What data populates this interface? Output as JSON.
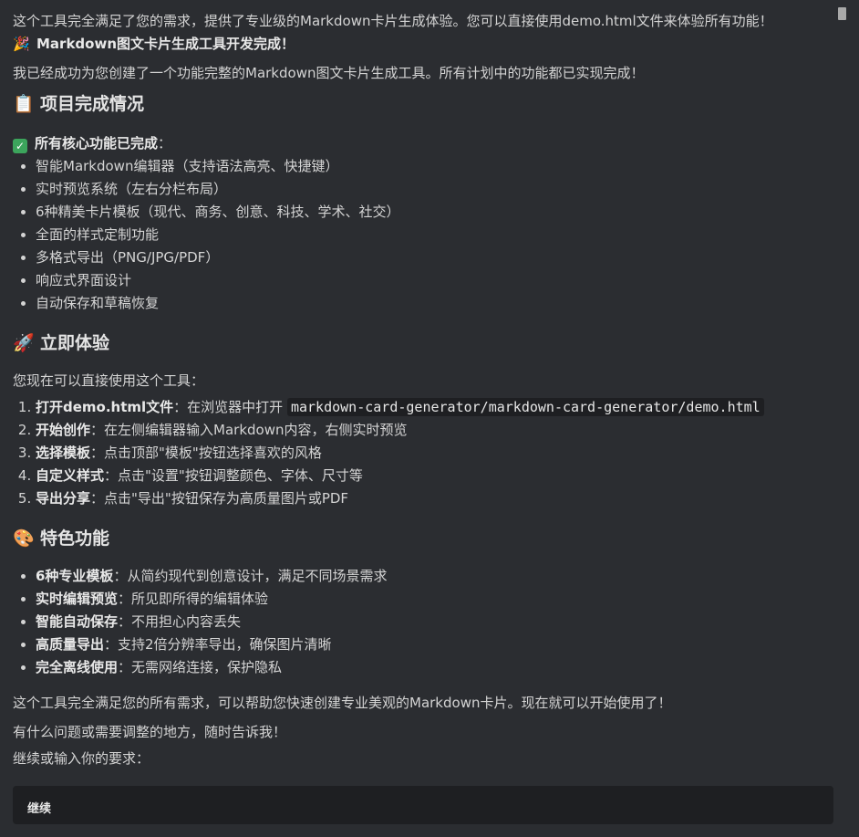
{
  "intro_line": "这个工具完全满足了您的需求，提供了专业级的Markdown卡片生成体验。您可以直接使用demo.html文件来体验所有功能！",
  "headline": {
    "emoji": "🎉",
    "text": "Markdown图文卡片生成工具开发完成！"
  },
  "summary": "我已经成功为您创建了一个功能完整的Markdown图文卡片生成工具。所有计划中的功能都已实现完成！",
  "section1": {
    "emoji": "📋",
    "title": "项目完成情况",
    "subtitle": "所有核心功能已完成",
    "subtitle_suffix": "：",
    "items": [
      "智能Markdown编辑器（支持语法高亮、快捷键）",
      "实时预览系统（左右分栏布局）",
      "6种精美卡片模板（现代、商务、创意、科技、学术、社交）",
      "全面的样式定制功能",
      "多格式导出（PNG/JPG/PDF）",
      "响应式界面设计",
      "自动保存和草稿恢复"
    ]
  },
  "section2": {
    "emoji": "🚀",
    "title": "立即体验",
    "intro": "您现在可以直接使用这个工具：",
    "steps": [
      {
        "label": "打开demo.html文件",
        "text": "：在浏览器中打开 ",
        "code": "markdown-card-generator/markdown-card-generator/demo.html"
      },
      {
        "label": "开始创作",
        "text": "：在左侧编辑器输入Markdown内容，右侧实时预览"
      },
      {
        "label": "选择模板",
        "text": "：点击顶部\"模板\"按钮选择喜欢的风格"
      },
      {
        "label": "自定义样式",
        "text": "：点击\"设置\"按钮调整颜色、字体、尺寸等"
      },
      {
        "label": "导出分享",
        "text": "：点击\"导出\"按钮保存为高质量图片或PDF"
      }
    ]
  },
  "section3": {
    "emoji": "🎨",
    "title": "特色功能",
    "items": [
      {
        "label": "6种专业模板",
        "text": "：从简约现代到创意设计，满足不同场景需求"
      },
      {
        "label": "实时编辑预览",
        "text": "：所见即所得的编辑体验"
      },
      {
        "label": "智能自动保存",
        "text": "：不用担心内容丢失"
      },
      {
        "label": "高质量导出",
        "text": "：支持2倍分辨率导出，确保图片清晰"
      },
      {
        "label": "完全离线使用",
        "text": "：无需网络连接，保护隐私"
      }
    ]
  },
  "closing1": "这个工具完全满足您的所有需求，可以帮助您快速创建专业美观的Markdown卡片。现在就可以开始使用了！",
  "closing2": "有什么问题或需要调整的地方，随时告诉我！",
  "prompt_label": "继续或输入你的要求：",
  "input_value": "继续"
}
